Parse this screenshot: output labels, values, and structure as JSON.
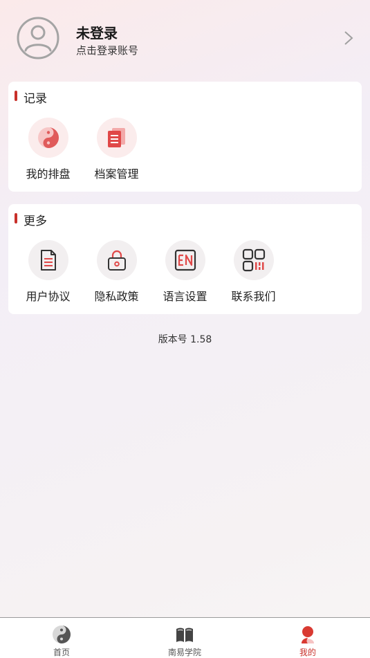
{
  "profile": {
    "title": "未登录",
    "subtitle": "点击登录账号"
  },
  "records": {
    "title": "记录",
    "items": [
      {
        "label": "我的排盘",
        "icon": "yin-yang-icon"
      },
      {
        "label": "档案管理",
        "icon": "document-stack-icon"
      }
    ]
  },
  "more": {
    "title": "更多",
    "items": [
      {
        "label": "用户协议",
        "icon": "document-icon"
      },
      {
        "label": "隐私政策",
        "icon": "lock-icon"
      },
      {
        "label": "语言设置",
        "icon": "language-en-icon"
      },
      {
        "label": "联系我们",
        "icon": "qr-code-icon"
      }
    ]
  },
  "version": "版本号 1.58",
  "tabbar": {
    "tabs": [
      {
        "label": "首页",
        "icon": "yin-yang-icon"
      },
      {
        "label": "南易学院",
        "icon": "book-icon"
      },
      {
        "label": "我的",
        "icon": "user-icon",
        "active": true
      }
    ]
  },
  "colors": {
    "accent": "#c8302a",
    "icon_pink": "#e36b6b"
  }
}
